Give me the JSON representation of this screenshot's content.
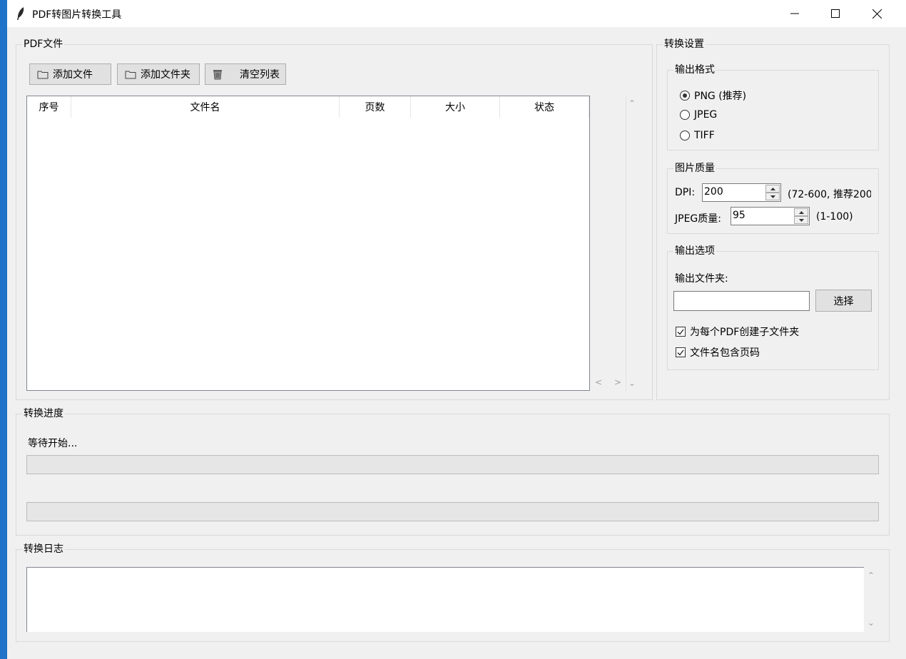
{
  "window": {
    "title": "PDF转图片转换工具"
  },
  "files_group": {
    "label": "PDF文件",
    "buttons": {
      "add_file": "添加文件",
      "add_folder": "添加文件夹",
      "clear_list": "清空列表"
    },
    "columns": [
      "序号",
      "文件名",
      "页数",
      "大小",
      "状态"
    ]
  },
  "settings": {
    "label": "转换设置",
    "format": {
      "label": "输出格式",
      "options": [
        "PNG (推荐)",
        "JPEG",
        "TIFF"
      ],
      "selected": "PNG (推荐)"
    },
    "quality": {
      "label": "图片质量",
      "dpi_label": "DPI:",
      "dpi_value": "200",
      "dpi_hint": "(72-600, 推荐200",
      "jpeg_label": "JPEG质量:",
      "jpeg_value": "95",
      "jpeg_hint": "(1-100)"
    },
    "output": {
      "label": "输出选项",
      "folder_label": "输出文件夹:",
      "folder_value": "",
      "choose_button": "选择",
      "subfolder_checkbox": "为每个PDF创建子文件夹",
      "subfolder_checked": true,
      "pagenum_checkbox": "文件名包含页码",
      "pagenum_checked": true
    }
  },
  "progress": {
    "label": "转换进度",
    "status": "等待开始...",
    "overall_fraction": 0,
    "file_fraction": 0
  },
  "log": {
    "label": "转换日志",
    "text": ""
  }
}
